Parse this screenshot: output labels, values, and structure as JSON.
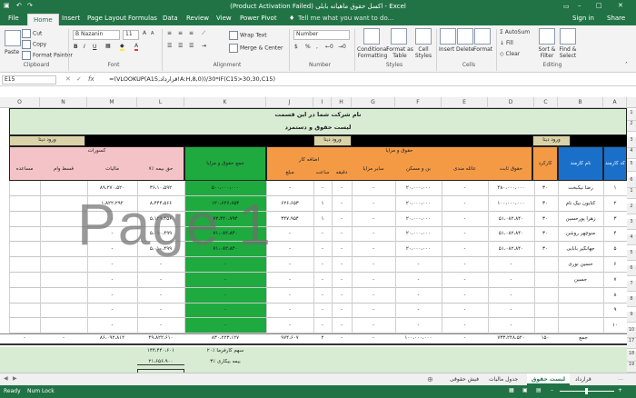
{
  "window": {
    "title": "(Product Activation Failed) اکسل حقوق ماهیانه بابلی - Excel",
    "user": "Sign in",
    "share": "Share"
  },
  "qat": {
    "save": "save",
    "undo": "undo",
    "redo": "redo"
  },
  "tabs": [
    "File",
    "Home",
    "Insert",
    "Page Layout",
    "Formulas",
    "Data",
    "Review",
    "View",
    "Power Pivot"
  ],
  "tell_me": "Tell me what you want to do...",
  "ribbon": {
    "clipboard": {
      "group": "Clipboard",
      "paste": "Paste",
      "cut": "Cut",
      "copy": "Copy",
      "format_painter": "Format Painter"
    },
    "font": {
      "group": "Font",
      "name": "B Nazanin",
      "size": "11",
      "bold": "B",
      "italic": "I",
      "underline": "U",
      "grow": "A",
      "shrink": "A"
    },
    "alignment": {
      "group": "Alignment",
      "wrap": "Wrap Text",
      "merge": "Merge & Center"
    },
    "number": {
      "group": "Number",
      "format": "Number",
      "pct": "%",
      "comma": ","
    },
    "styles": {
      "group": "Styles",
      "conditional": "Conditional Formatting",
      "format_table": "Format as Table",
      "cell_styles": "Cell Styles"
    },
    "cells": {
      "group": "Cells",
      "insert": "Insert",
      "delete": "Delete",
      "format": "Format"
    },
    "editing": {
      "group": "Editing",
      "autosum": "AutoSum",
      "fill": "Fill",
      "clear": "Clear",
      "sort": "Sort & Filter",
      "find": "Find & Select"
    }
  },
  "formula_bar": {
    "name_box": "E15",
    "fx": "fx",
    "formula": "=(VLOOKUP(A15,قرارداد!A:H,8,0))/30*IF(C15>30,30,C15)"
  },
  "columns": [
    "O",
    "N",
    "M",
    "L",
    "K",
    "J",
    "I",
    "H",
    "G",
    "F",
    "E",
    "D",
    "C",
    "B",
    "A"
  ],
  "rows": [
    "1",
    "2",
    "3",
    "4",
    "5",
    "6",
    "1",
    "2",
    "3",
    "4",
    "5",
    "6",
    "7",
    "8",
    "9",
    "10",
    "17",
    "18",
    "19"
  ],
  "sheet": {
    "company": "نام شرکت شما در این قسمت",
    "list_title": "لیست حقوق و دستمزد",
    "data_entry": "ورود دیتا",
    "deductions": "کسورات",
    "salaries_benefits": "حقوق و مزایا",
    "overtime": "اضافه کار",
    "headers": {
      "code": "کد کارمند",
      "name": "نام کارمند",
      "days": "کارکرد",
      "base": "حقوق ثابت",
      "family": "عائله مندی",
      "housing": "بن و مسکن",
      "other": "سایر مزایا",
      "minute": "دقیقه",
      "hour": "ساعت",
      "amount": "مبلغ",
      "total": "جمع حقوق و مزایا",
      "insurance": "۷٪ حق بیمه",
      "tax": "مالیات",
      "loan": "قسط وام",
      "assist": "مساعده"
    },
    "employees": [
      {
        "code": "۱",
        "name": "رضا نیکبخت",
        "days": "۳۰",
        "base": "۴۸۰،۰۰۰،۰۰۰",
        "family": "-",
        "housing": "۲۰،۰۰۰،۰۰۰",
        "other": "-",
        "minute": "-",
        "hour": "-",
        "amount": "-",
        "total": "۵۰۰،۰۰۰،۰۰۰",
        "insurance": "۳۶،۱۰،۵۹۲",
        "tax": "۸۹،۲۷۰،۵۲۰"
      },
      {
        "code": "۲",
        "name": "کتایون نیک نام",
        "days": "۳۰",
        "base": "۱۰۰،۰۰۰،۰۰۰",
        "family": "-",
        "housing": "۲۰،۰۰۰،۰۰۰",
        "other": "-",
        "minute": "-",
        "hour": "۱",
        "amount": "۶۲۶،۶۵۳",
        "total": "۱۲۰،۶۲۶،۶۵۳",
        "insurance": "۸،۴۴۴،۵۶۶",
        "tax": "۱،۸۲۲،۲۹۲"
      },
      {
        "code": "۳",
        "name": "زهرا پورحسین",
        "days": "۳۰",
        "base": "۵۱،۰۸۲،۸۴۰",
        "family": "-",
        "housing": "۲۰،۰۰۰،۰۰۰",
        "other": "-",
        "minute": "-",
        "hour": "۱",
        "amount": "۳۴۷،۹۵۴",
        "total": "۷۲،۴۲۰،۷۹۴",
        "insurance": "۵،۱۲۹،۴۵۶",
        "tax": "-"
      },
      {
        "code": "۴",
        "name": "منوچهر روشن",
        "days": "۳۰",
        "base": "۵۱،۰۸۲،۸۴۰",
        "family": "-",
        "housing": "۲۰،۰۰۰،۰۰۰",
        "other": "-",
        "minute": "-",
        "hour": "-",
        "amount": "-",
        "total": "۷۱،۰۸۲،۸۴۰",
        "insurance": "۵،۰۱۰،۴۹۹",
        "tax": "-"
      },
      {
        "code": "۵",
        "name": "جهانگیر بابایی",
        "days": "۳۰",
        "base": "۵۱،۰۸۲،۸۴۰",
        "family": "-",
        "housing": "۲۰،۰۰۰،۰۰۰",
        "other": "-",
        "minute": "-",
        "hour": "-",
        "amount": "-",
        "total": "۷۱،۰۸۲،۸۴۰",
        "insurance": "۵،۰۱۰،۴۹۹",
        "tax": "-"
      },
      {
        "code": "۶",
        "name": "حسین نوری",
        "days": "",
        "base": "-",
        "family": "-",
        "housing": "-",
        "other": "-",
        "minute": "-",
        "hour": "-",
        "amount": "-",
        "total": "-",
        "insurance": "-",
        "tax": "-"
      },
      {
        "code": "۷",
        "name": "حسین",
        "days": "",
        "base": "-",
        "family": "-",
        "housing": "-",
        "other": "-",
        "minute": "-",
        "hour": "-",
        "amount": "-",
        "total": "-",
        "insurance": "-",
        "tax": "-"
      },
      {
        "code": "۸",
        "name": "",
        "days": "",
        "base": "-",
        "family": "-",
        "housing": "-",
        "other": "-",
        "minute": "-",
        "hour": "-",
        "amount": "-",
        "total": "-",
        "insurance": "-",
        "tax": "-"
      },
      {
        "code": "۹",
        "name": "",
        "days": "",
        "base": "-",
        "family": "-",
        "housing": "-",
        "other": "-",
        "minute": "-",
        "hour": "-",
        "amount": "-",
        "total": "-",
        "insurance": "-",
        "tax": "-"
      },
      {
        "code": "۱۰",
        "name": "",
        "days": "",
        "base": "-",
        "family": "-",
        "housing": "-",
        "other": "-",
        "minute": "-",
        "hour": "-",
        "amount": "-",
        "total": "-",
        "insurance": "-",
        "tax": "-"
      }
    ],
    "total_row": {
      "label": "جمع",
      "days": "۱۵۰",
      "base": "۷۳۳،۲۴۸،۵۲۰",
      "family": "-",
      "housing": "۱۰۰،۰۰۰،۰۰۰",
      "other": "-",
      "minute": "-",
      "hour": "۲",
      "amount": "۹۷۴،۶۰۷",
      "total": "۸۳۰،۲۲۳،۱۲۷",
      "insurance": "۴۹،۸۲۲،۶۱۰",
      "tax": "۸۶،۰۹۲،۸۱۲",
      "loan": "-",
      "assist": "-"
    },
    "employer_share_label": "۲۰٪ سهم کارفرما",
    "employer_share_value": "۱۴۴،۴۴۰،۶۰۱",
    "unemployment_label": "۳٪ بیمه بیکاری",
    "unemployment_value": "۲۱،۶۵۶،۹۰۰"
  },
  "watermark": "Page 1",
  "sheet_tabs": [
    "قرارداد",
    "لیست حقوق",
    "جدول مالیات",
    "فیش حقوقی"
  ],
  "status": {
    "ready": "Ready",
    "numlock": "Num Lock"
  }
}
